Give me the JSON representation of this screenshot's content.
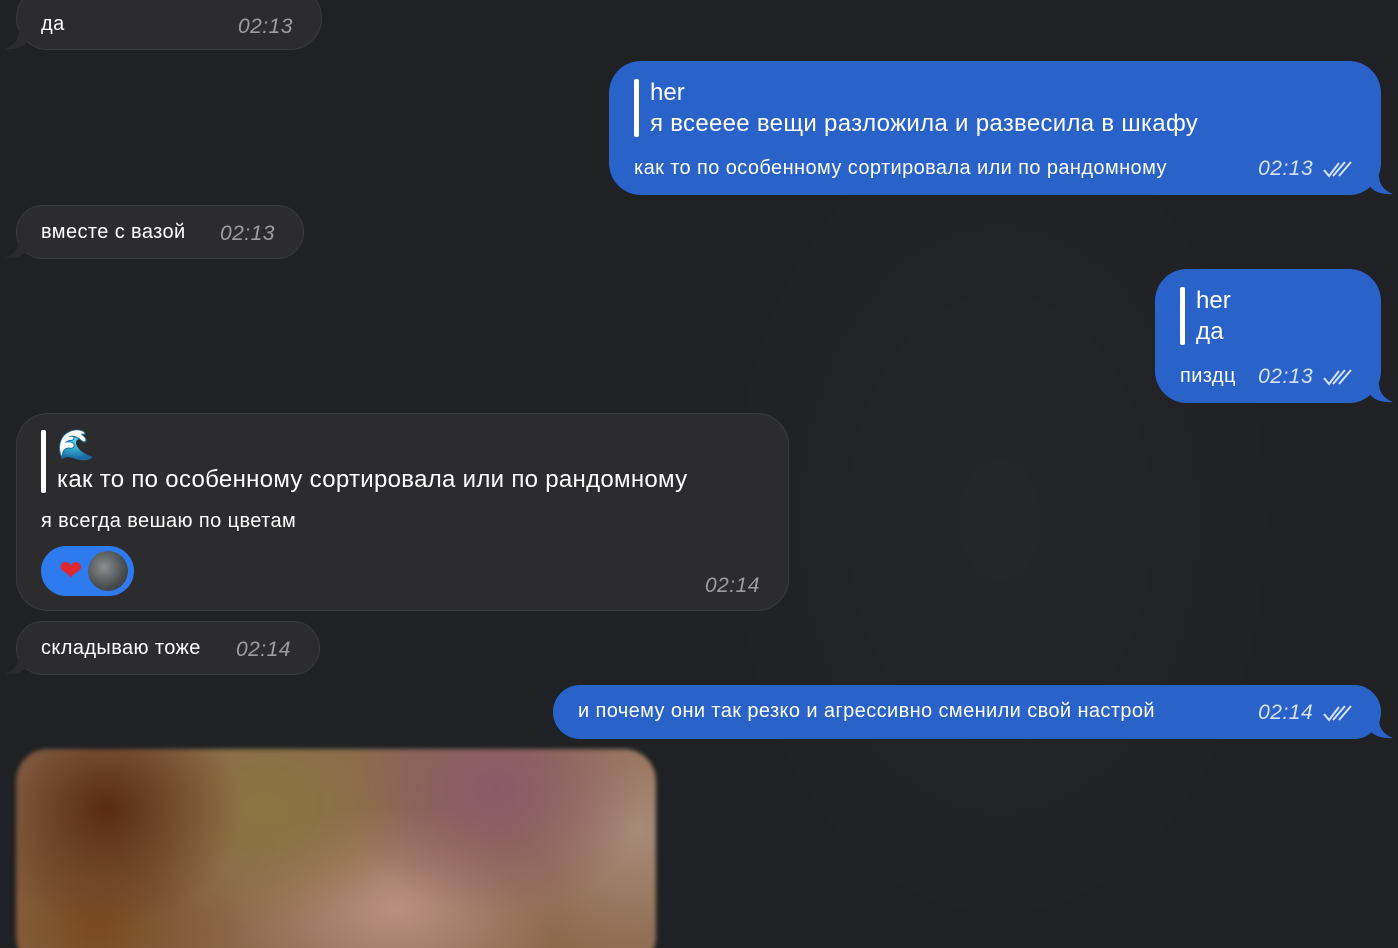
{
  "messages": [
    {
      "id": "m1",
      "direction": "in",
      "text": "да",
      "time": "02:13"
    },
    {
      "id": "m2",
      "direction": "out",
      "reply": {
        "name": "her",
        "text": "я всееее вещи разложила и развесила в шкафу"
      },
      "text": "как то по особенному сортировала или по рандомному",
      "time": "02:13",
      "status": "read"
    },
    {
      "id": "m3",
      "direction": "in",
      "text": "вместе с вазой",
      "time": "02:13"
    },
    {
      "id": "m4",
      "direction": "out",
      "reply": {
        "name": "her",
        "text": "да"
      },
      "text": "пиздц",
      "time": "02:13",
      "status": "read"
    },
    {
      "id": "m5",
      "direction": "in",
      "reply": {
        "name": "🌊",
        "text": "как то по особенному сортировала или по рандомному"
      },
      "text": "я всегда вешаю по цветам",
      "time": "02:14",
      "reactions": {
        "emoji": "❤️",
        "icon": "heart-icon"
      }
    },
    {
      "id": "m6",
      "direction": "in",
      "text": "складываю тоже",
      "time": "02:14"
    },
    {
      "id": "m7",
      "direction": "out",
      "text": "и почему они так резко и агрессивно сменили свой настрой",
      "time": "02:14",
      "status": "read"
    },
    {
      "id": "m8",
      "direction": "in",
      "type": "photo"
    }
  ],
  "icons": {
    "read_status": "double-check-icon",
    "avatar": "reactor-avatar"
  },
  "colors": {
    "background": "#1f2124",
    "incoming": "#2c2c2e",
    "outgoing": "#2962c9",
    "reaction": "#2e7bf0"
  }
}
